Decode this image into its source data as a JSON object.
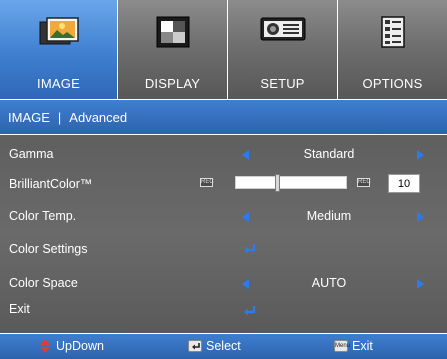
{
  "tabs": [
    {
      "label": "IMAGE",
      "icon": "photo-icon",
      "active": true
    },
    {
      "label": "DISPLAY",
      "icon": "display-icon",
      "active": false
    },
    {
      "label": "SETUP",
      "icon": "projector-icon",
      "active": false
    },
    {
      "label": "OPTIONS",
      "icon": "options-icon",
      "active": false
    }
  ],
  "breadcrumb": {
    "root": "IMAGE",
    "separator": "|",
    "current": "Advanced"
  },
  "menu": {
    "gamma": {
      "label": "Gamma",
      "value": "Standard"
    },
    "brilliant_color": {
      "label": "BrilliantColor™",
      "value": "10",
      "level_fraction": 0.37
    },
    "color_temp": {
      "label": "Color Temp.",
      "value": "Medium"
    },
    "color_settings": {
      "label": "Color Settings"
    },
    "color_space": {
      "label": "Color Space",
      "value": "AUTO"
    },
    "exit": {
      "label": "Exit"
    }
  },
  "footer": {
    "updown": "UpDown",
    "select": "Select",
    "exit": "Exit",
    "menu_key": "Menu"
  },
  "colors": {
    "accent_blue": "#2b7bf0",
    "bar_blue": "#3f7fd0",
    "menu_gray": "#636363",
    "updown_red": "#e03a3a"
  }
}
